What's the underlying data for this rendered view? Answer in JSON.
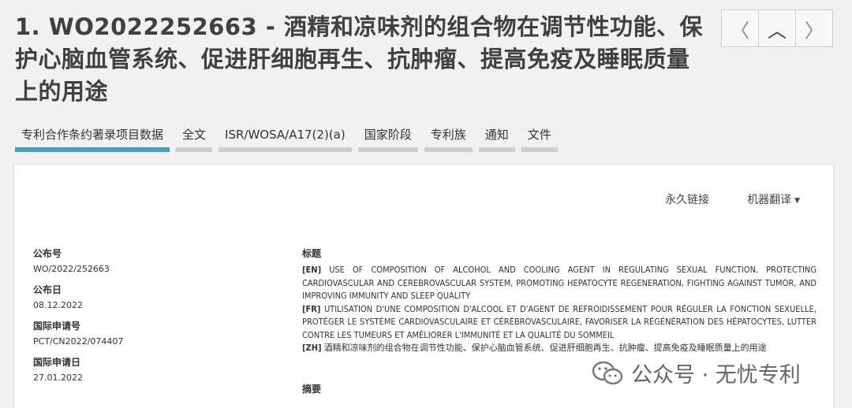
{
  "header": {
    "title": "1. WO2022252663 - 酒精和凉味剂的组合物在调节性功能、保护心脑血管系统、促进肝细胞再生、抗肿瘤、提高免疫及睡眠质量上的用途",
    "nav": {
      "prev": "〈",
      "up": "︿",
      "next": "〉"
    }
  },
  "tabs": [
    {
      "label": "专利合作条约著录项目数据"
    },
    {
      "label": "全文"
    },
    {
      "label": "ISR/WOSA/A17(2)(a)"
    },
    {
      "label": "国家阶段"
    },
    {
      "label": "专利族"
    },
    {
      "label": "通知"
    },
    {
      "label": "文件"
    }
  ],
  "toolbar": {
    "permalink": "永久链接",
    "machine_translation": "机器翻译"
  },
  "biblio": {
    "pub_no_label": "公布号",
    "pub_no": "WO/2022/252663",
    "pub_date_label": "公布日",
    "pub_date": "08.12.2022",
    "app_no_label": "国际申请号",
    "app_no": "PCT/CN2022/074407",
    "app_date_label": "国际申请日",
    "app_date": "27.01.2022"
  },
  "titles": {
    "heading": "标题",
    "en_tag": "[EN]",
    "en": "USE OF COMPOSITION OF ALCOHOL AND COOLING AGENT IN REGULATING SEXUAL FUNCTION, PROTECTING CARDIOVASCULAR AND CEREBROVASCULAR SYSTEM, PROMOTING HEPATOCYTE REGENERATION, FIGHTING AGAINST TUMOR, AND IMPROVING IMMUNITY AND SLEEP QUALITY",
    "fr_tag": "[FR]",
    "fr": "UTILISATION D'UNE COMPOSITION D'ALCOOL ET D'AGENT DE REFROIDISSEMENT POUR RÉGULER LA FONCTION SEXUELLE, PROTÉGER LE SYSTÈME CARDIOVASCULAIRE ET CÉRÉBROVASCULAIRE, FAVORISER LA RÉGÉNÉRATION DES HÉPATOCYTES, LUTTER CONTRE LES TUMEURS ET AMÉLIORER L'IMMUNITÉ ET LA QUALITÉ DU SOMMEIL",
    "zh_tag": "[ZH]",
    "zh": "酒精和凉味剂的组合物在调节性功能、保护心脑血管系统、促进肝细胞再生、抗肿瘤、提高免疫及睡眠质量上的用途"
  },
  "abstract": {
    "heading": "摘要"
  },
  "watermark": {
    "text": "公众号 · 无忧专利"
  }
}
